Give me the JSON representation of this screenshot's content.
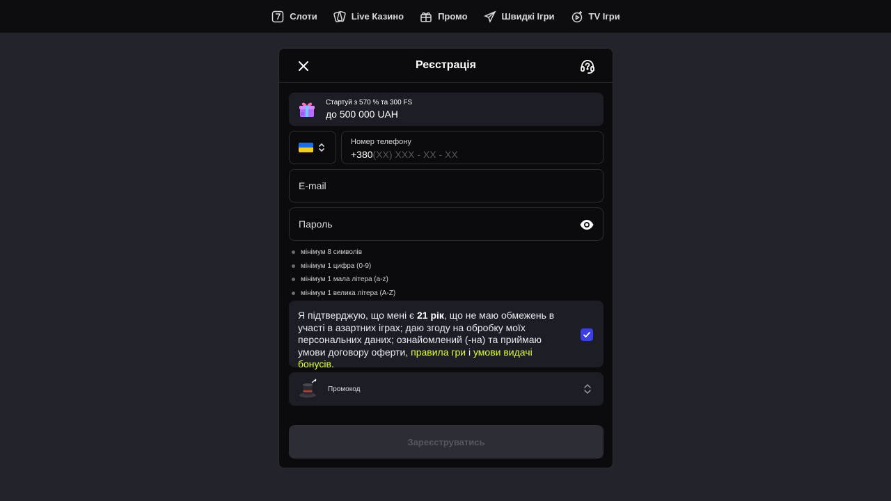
{
  "nav": {
    "items": [
      {
        "label": "Слоти",
        "icon": "slot-seven-icon"
      },
      {
        "label": "Live Казино",
        "icon": "cards-icon"
      },
      {
        "label": "Промо",
        "icon": "gift-icon"
      },
      {
        "label": "Швидкі Ігри",
        "icon": "paper-plane-icon"
      },
      {
        "label": "TV Ігри",
        "icon": "tv-play-icon"
      }
    ]
  },
  "modal": {
    "title": "Реєстрація",
    "bonus": {
      "line1": "Стартуй з 570 % та 300 FS",
      "line2": "до 500 000 UAH",
      "icon": "gift-box-icon"
    },
    "phone": {
      "label": "Номер телефону",
      "prefix": "+380",
      "mask": "(XX) XXX - XX - XX",
      "country_flag": "ukraine-flag-icon"
    },
    "email": {
      "placeholder": "E-mail"
    },
    "password": {
      "placeholder": "Пароль"
    },
    "password_rules": [
      "мінімум 8 символів",
      "мінімум 1 цифра (0-9)",
      "мінімум 1 мала літера (a-z)",
      "мінімум 1 велика літера (A-Z)"
    ],
    "consent": {
      "part1": "Я підтверджую, що мені є ",
      "age": "21 рік",
      "part2": ", що не маю обмежень в участі в азартних іграх; даю згоду на обробку моїх персональних даних; ознайомлений (-на) та приймаю умови договору оферти, ",
      "link1": "правила гри",
      "sep": " і ",
      "link2": "умови видачі бонусів",
      "end": ".",
      "checked": true
    },
    "promo": {
      "label": "Промокод",
      "icon": "magic-hat-icon"
    },
    "submit_label": "Зареєструватись"
  },
  "colors": {
    "background": "#22232b",
    "modal": "#0b0b0d",
    "card": "#1d1e25",
    "accent_link": "#d8ff3a",
    "checkbox": "#3b3fe6"
  }
}
